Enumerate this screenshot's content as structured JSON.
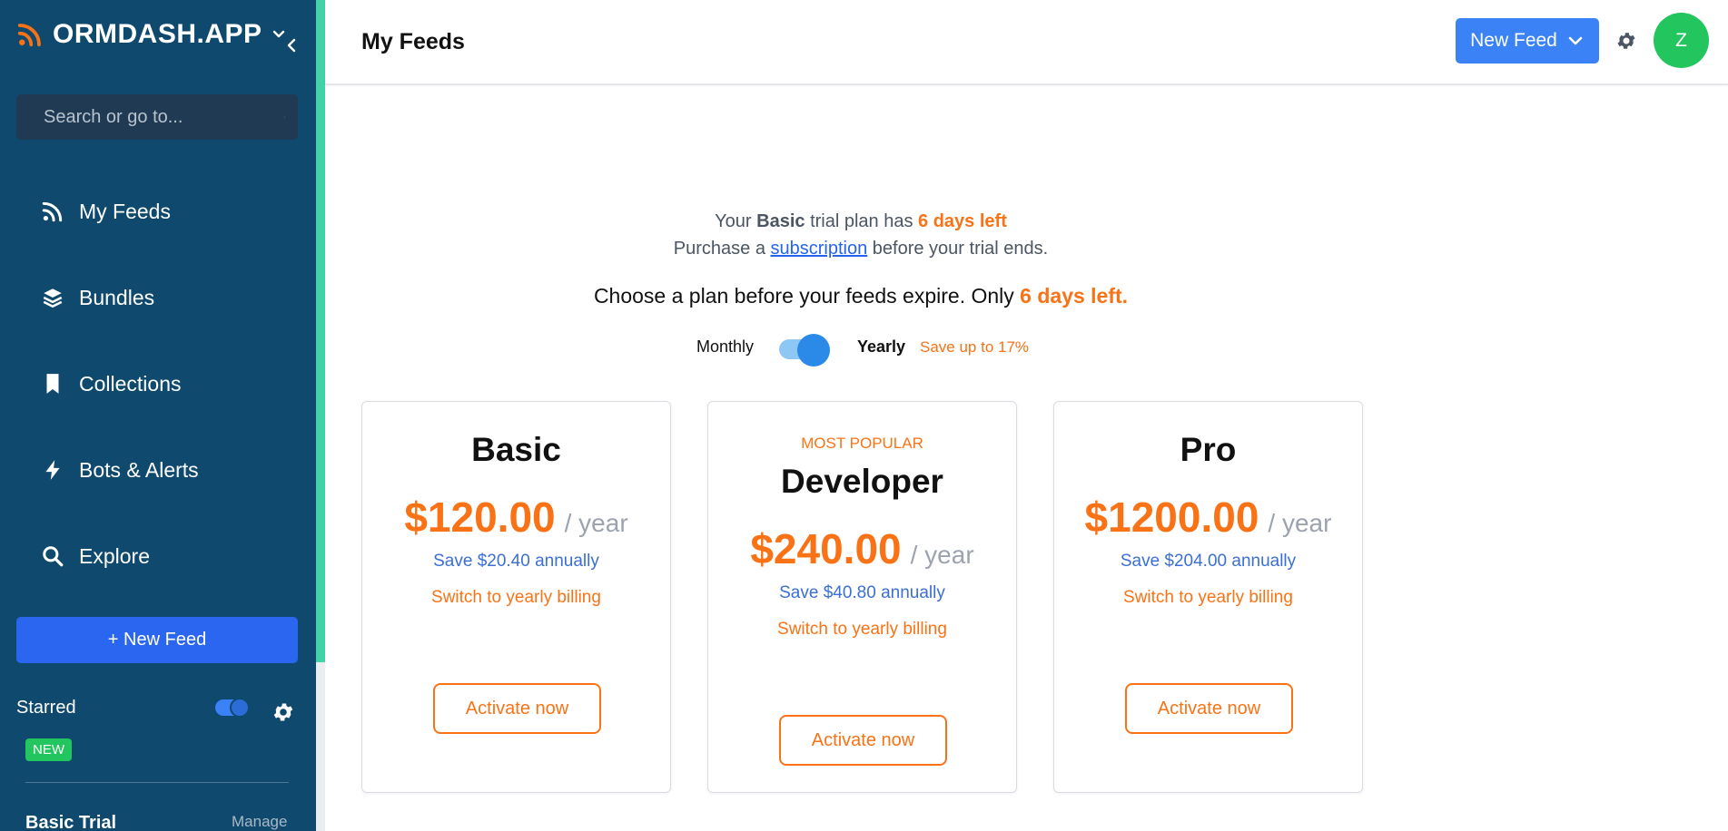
{
  "sidebar": {
    "brand": "ORMDASH.APP",
    "search_placeholder": "Search or go to...",
    "nav": [
      {
        "label": "My Feeds",
        "icon": "rss-icon"
      },
      {
        "label": "Bundles",
        "icon": "layers-icon"
      },
      {
        "label": "Collections",
        "icon": "bookmark-icon"
      },
      {
        "label": "Bots & Alerts",
        "icon": "bolt-icon"
      },
      {
        "label": "Explore",
        "icon": "search-icon"
      }
    ],
    "new_feed_button": "+ New Feed",
    "starred_label": "Starred",
    "new_badge": "NEW",
    "plan_label": "Basic Trial",
    "manage_link": "Manage"
  },
  "header": {
    "title": "My Feeds",
    "new_feed_button": "New Feed",
    "avatar_initial": "Z"
  },
  "main": {
    "trial": {
      "prefix": "Your",
      "plan": "Basic",
      "middle": "trial plan has",
      "days_left": "6 days left",
      "purchase_prefix": "Purchase a",
      "subscription_link": "subscription",
      "purchase_suffix": "before your trial ends."
    },
    "choose_text": "Choose a plan before your feeds expire. Only",
    "choose_days": "6 days left.",
    "billing": {
      "monthly": "Monthly",
      "yearly": "Yearly",
      "save": "Save up to 17%",
      "selected": "Yearly"
    },
    "plans": [
      {
        "name": "Basic",
        "badge": "",
        "price": "$120.00",
        "period": "/ year",
        "save": "Save $20.40 annually",
        "switch": "Switch to yearly billing",
        "button": "Activate now"
      },
      {
        "name": "Developer",
        "badge": "MOST POPULAR",
        "price": "$240.00",
        "period": "/ year",
        "save": "Save $40.80 annually",
        "switch": "Switch to yearly billing",
        "button": "Activate now"
      },
      {
        "name": "Pro",
        "badge": "",
        "price": "$1200.00",
        "period": "/ year",
        "save": "Save $204.00 annually",
        "switch": "Switch to yearly billing",
        "button": "Activate now"
      }
    ]
  },
  "colors": {
    "sidebar_bg": "#0f4a6e",
    "accent_teal": "#43d1a8",
    "primary_blue": "#3b82f6",
    "accent_orange": "#f97316",
    "avatar_green": "#22c55e"
  }
}
